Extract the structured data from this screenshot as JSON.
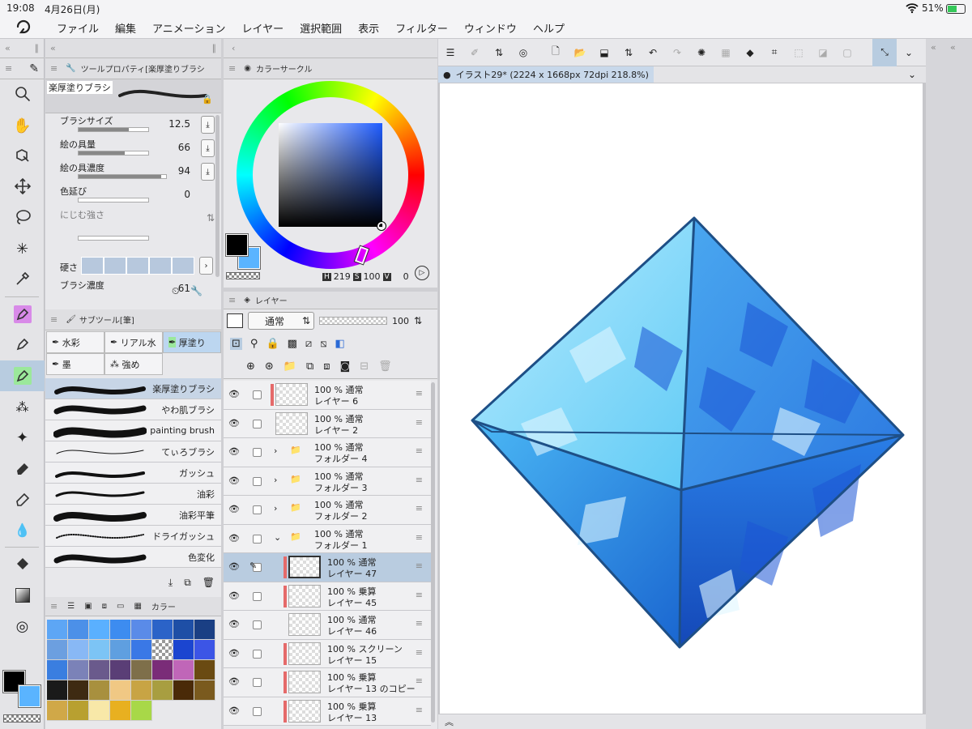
{
  "status": {
    "time": "19:08",
    "date": "4月26日(月)",
    "battery": "51%"
  },
  "menu": {
    "items": [
      "ファイル",
      "編集",
      "アニメーション",
      "レイヤー",
      "選択範囲",
      "表示",
      "フィルター",
      "ウィンドウ",
      "ヘルプ"
    ]
  },
  "toolprop": {
    "title": "ツールプロパティ[楽厚塗りブラシ",
    "brush_name": "楽厚塗りブラシ",
    "rows": [
      {
        "label": "ブラシサイズ",
        "value": "12.5",
        "fill": 0.72
      },
      {
        "label": "絵の具量",
        "value": "66",
        "fill": 0.66
      },
      {
        "label": "絵の具濃度",
        "value": "94",
        "fill": 0.94
      },
      {
        "label": "色延び",
        "value": "0",
        "fill": 0
      }
    ],
    "blend_label": "にじむ強さ",
    "hardness_label": "硬さ",
    "density_label": "ブラシ濃度",
    "density_value": "61"
  },
  "subtool": {
    "title": "サブツール[筆]",
    "tabs": [
      "水彩",
      "リアル水",
      "厚塗り",
      "墨",
      "強め"
    ],
    "brushes": [
      "楽厚塗りブラシ",
      "やわ肌ブラシ",
      "painting brush",
      "てぃろブラシ",
      "ガッシュ",
      "油彩",
      "油彩平筆",
      "ドライガッシュ",
      "色変化"
    ]
  },
  "colorset": {
    "tab_label": "カラー",
    "colors": [
      "#5da6f5",
      "#4c90e8",
      "#5ab0ff",
      "#3d8cf0",
      "#5a8be8",
      "#2b63c8",
      "#1e4fa6",
      "#1a3f84",
      "#6c9fe0",
      "#88b8f5",
      "#7cc4f5",
      "#5f9fe0",
      "#3a78e6",
      "#checker",
      "#1b45d0",
      "#3c55e6",
      "#3a7ee0",
      "#7b82b8",
      "#6a5a8c",
      "#5a3e76",
      "#7e6f4a",
      "#7a2c78",
      "#c066b8",
      "#6a4a12",
      "#1a1a1a",
      "#3e2a12",
      "#a8903e",
      "#f0c884",
      "#c8a444",
      "#a89e40",
      "#4a2a08",
      "#7a5a1e",
      "#d0a848",
      "#b8a030",
      "#f8e8a8",
      "#e8b020",
      "#a8d848"
    ]
  },
  "colorcircle": {
    "title": "カラーサークル",
    "h_label": "H",
    "h": "219",
    "s_label": "S",
    "s": "100",
    "v_label": "V",
    "v": "0",
    "main": "#000000",
    "sub": "#5ab4ff"
  },
  "layers": {
    "title": "レイヤー",
    "blend_mode": "通常",
    "opacity": "100",
    "rows": [
      {
        "pct": "100 %",
        "mode": "通常",
        "name": "レイヤー 6",
        "indent": 0,
        "folder": false,
        "bar": true,
        "sel": false
      },
      {
        "pct": "100 %",
        "mode": "通常",
        "name": "レイヤー 2",
        "indent": 0,
        "folder": false,
        "bar": false,
        "sel": false
      },
      {
        "pct": "100 %",
        "mode": "通常",
        "name": "フォルダー 4",
        "indent": 0,
        "folder": true,
        "open": false,
        "sel": false
      },
      {
        "pct": "100 %",
        "mode": "通常",
        "name": "フォルダー 3",
        "indent": 0,
        "folder": true,
        "open": false,
        "sel": false
      },
      {
        "pct": "100 %",
        "mode": "通常",
        "name": "フォルダー 2",
        "indent": 0,
        "folder": true,
        "open": false,
        "sel": false
      },
      {
        "pct": "100 %",
        "mode": "通常",
        "name": "フォルダー 1",
        "indent": 0,
        "folder": true,
        "open": true,
        "sel": false
      },
      {
        "pct": "100 %",
        "mode": "通常",
        "name": "レイヤー 47",
        "indent": 1,
        "folder": false,
        "bar": true,
        "sel": true
      },
      {
        "pct": "100 %",
        "mode": "乗算",
        "name": "レイヤー 45",
        "indent": 1,
        "folder": false,
        "bar": true,
        "sel": false
      },
      {
        "pct": "100 %",
        "mode": "通常",
        "name": "レイヤー 46",
        "indent": 1,
        "folder": false,
        "bar": false,
        "sel": false
      },
      {
        "pct": "100 %",
        "mode": "スクリーン",
        "name": "レイヤー 15",
        "indent": 1,
        "folder": false,
        "bar": true,
        "sel": false
      },
      {
        "pct": "100 %",
        "mode": "乗算",
        "name": "レイヤー 13 のコピー",
        "indent": 1,
        "folder": false,
        "bar": true,
        "sel": false
      },
      {
        "pct": "100 %",
        "mode": "乗算",
        "name": "レイヤー 13",
        "indent": 1,
        "folder": false,
        "bar": true,
        "sel": false
      }
    ]
  },
  "canvas": {
    "tab_title": "イラスト29* (2224 x 1668px 72dpi 218.8%)"
  }
}
